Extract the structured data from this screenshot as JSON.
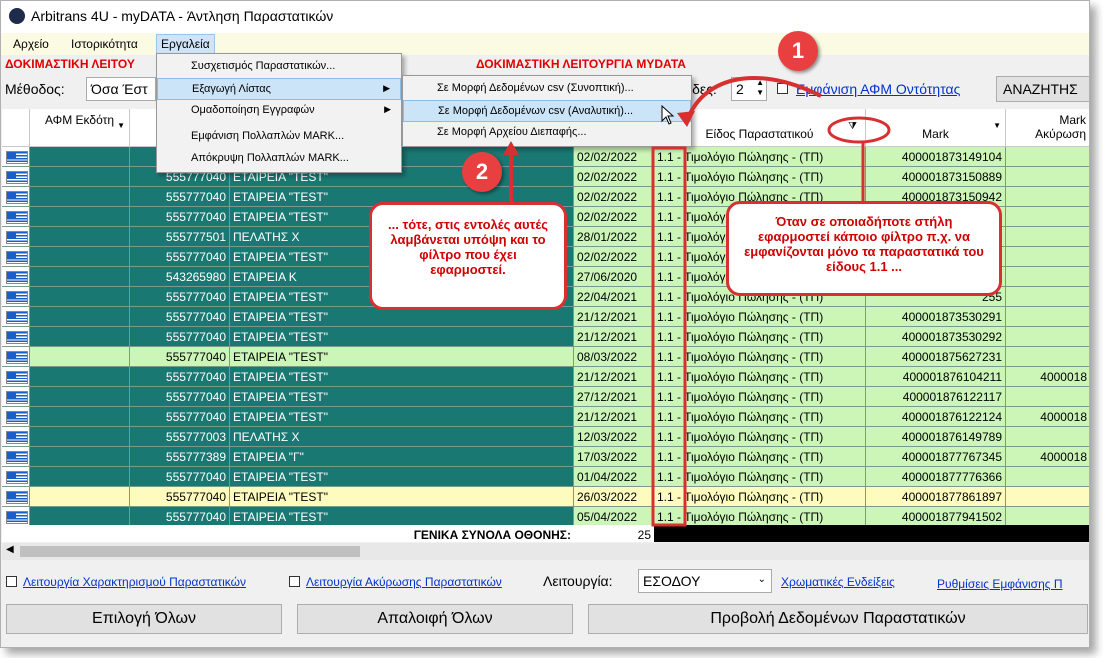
{
  "window": {
    "title": "Arbitrans 4U - myDATA - Άντληση Παραστατικών"
  },
  "menu": {
    "items": [
      "Αρχείο",
      "Ιστορικότητα",
      "Εργαλεία"
    ]
  },
  "banner": {
    "left": "ΔΟΚΙΜΑΣΤΙΚΗ ΛΕΙΤΟΥ",
    "center": "ΔΟΚΙΜΑΣΤΙΚΗ ΛΕΙΤΟΥΡΓΙΑ MYDATA"
  },
  "toolbar": {
    "method_label": "Μέθοδος:",
    "method_value": "Όσα Έστ",
    "pages_label_suffix": "ίδες:",
    "pages_value": "2",
    "show_afm_link": "Εμφάνιση ΑΦΜ Οντότητας",
    "search_button": "ΑΝΑΖΗΤΗΣ"
  },
  "tools_menu": {
    "items": [
      "Συσχετισμός Παραστατικών...",
      "Εξαγωγή Λίστας",
      "Ομαδοποίηση Εγγραφών",
      "Εμφάνιση Πολλαπλών MARK...",
      "Απόκρυψη Πολλαπλών MARK..."
    ]
  },
  "export_submenu": {
    "items": [
      "Σε Μορφή Δεδομένων csv (Συνοπτική)...",
      "Σε Μορφή Δεδομένων csv (Αναλυτική)...",
      "Σε Μορφή Αρχείου Διεπαφής..."
    ]
  },
  "grid": {
    "headers": {
      "afm_issuer": "ΑΦΜ Εκδότη",
      "doc_type": "Είδος Παραστατικού",
      "mark": "Mark",
      "mark_cancel": "Mark Ακύρωση"
    },
    "rows": [
      {
        "afm": "555777040",
        "name": "",
        "date": "02/02/2022",
        "type": "1.1 - Τιμολόγιο Πώλησης - (ΤΠ)",
        "mark": "400001873149104",
        "cancel": "",
        "color": "teal"
      },
      {
        "afm": "555777040",
        "name": "ΕΤΑΙΡΕΙΑ \"TEST\"",
        "date": "02/02/2022",
        "type": "1.1 - Τιμολόγιο Πώλησης - (ΤΠ)",
        "mark": "400001873150889",
        "cancel": "",
        "color": "teal"
      },
      {
        "afm": "555777040",
        "name": "ΕΤΑΙΡΕΙΑ \"TEST\"",
        "date": "02/02/2022",
        "type": "1.1 - Τιμολόγιο Πώλησης - (ΤΠ)",
        "mark": "400001873150942",
        "cancel": "",
        "color": "teal"
      },
      {
        "afm": "555777040",
        "name": "ΕΤΑΙΡΕΙΑ \"TEST\"",
        "date": "02/02/2022",
        "type": "1.1 - Τιμολόγιο Πώλησης - (ΤΠ)",
        "mark": "",
        "cancel": "",
        "color": "teal"
      },
      {
        "afm": "555777501",
        "name": "ΠΕΛΑΤΗΣ Χ",
        "date": "28/01/2022",
        "type": "1.1 - Τιμολόγιο Πώλησης - (ΤΠ)",
        "mark": "",
        "cancel": "",
        "color": "teal"
      },
      {
        "afm": "555777040",
        "name": "ΕΤΑΙΡΕΙΑ \"TEST\"",
        "date": "02/02/2022",
        "type": "1.1 - Τιμολόγιο Πώλησης - (ΤΠ)",
        "mark": "",
        "cancel": "",
        "color": "teal"
      },
      {
        "afm": "543265980",
        "name": "ΕΤΑΙΡΕΙΑ Κ",
        "date": "27/06/2020",
        "type": "1.1 - Τιμολόγιο Πώλησης - (ΤΠ)",
        "mark": "",
        "cancel": "",
        "color": "teal"
      },
      {
        "afm": "555777040",
        "name": "ΕΤΑΙΡΕΙΑ \"TEST\"",
        "date": "22/04/2021",
        "type": "1.1 - Τιμολόγιο Πώλησης - (ΤΠ)",
        "mark": "255",
        "cancel": "",
        "color": "teal"
      },
      {
        "afm": "555777040",
        "name": "ΕΤΑΙΡΕΙΑ \"TEST\"",
        "date": "21/12/2021",
        "type": "1.1 - Τιμολόγιο Πώλησης - (ΤΠ)",
        "mark": "400001873530291",
        "cancel": "",
        "color": "teal"
      },
      {
        "afm": "555777040",
        "name": "ΕΤΑΙΡΕΙΑ \"TEST\"",
        "date": "21/12/2021",
        "type": "1.1 - Τιμολόγιο Πώλησης - (ΤΠ)",
        "mark": "400001873530292",
        "cancel": "",
        "color": "teal"
      },
      {
        "afm": "555777040",
        "name": "ΕΤΑΙΡΕΙΑ \"TEST\"",
        "date": "08/03/2022",
        "type": "1.1 - Τιμολόγιο Πώλησης - (ΤΠ)",
        "mark": "400001875627231",
        "cancel": "",
        "color": "green"
      },
      {
        "afm": "555777040",
        "name": "ΕΤΑΙΡΕΙΑ \"TEST\"",
        "date": "21/12/2021",
        "type": "1.1 - Τιμολόγιο Πώλησης - (ΤΠ)",
        "mark": "400001876104211",
        "cancel": "4000018",
        "color": "teal"
      },
      {
        "afm": "555777040",
        "name": "ΕΤΑΙΡΕΙΑ \"TEST\"",
        "date": "27/12/2021",
        "type": "1.1 - Τιμολόγιο Πώλησης - (ΤΠ)",
        "mark": "400001876122117",
        "cancel": "",
        "color": "teal"
      },
      {
        "afm": "555777040",
        "name": "ΕΤΑΙΡΕΙΑ \"TEST\"",
        "date": "21/12/2021",
        "type": "1.1 - Τιμολόγιο Πώλησης - (ΤΠ)",
        "mark": "400001876122124",
        "cancel": "4000018",
        "color": "teal"
      },
      {
        "afm": "555777003",
        "name": "ΠΕΛΑΤΗΣ Χ",
        "date": "12/03/2022",
        "type": "1.1 - Τιμολόγιο Πώλησης - (ΤΠ)",
        "mark": "400001876149789",
        "cancel": "",
        "color": "teal"
      },
      {
        "afm": "555777389",
        "name": "ΕΤΑΙΡΕΙΑ \"Γ\"",
        "date": "17/03/2022",
        "type": "1.1 - Τιμολόγιο Πώλησης - (ΤΠ)",
        "mark": "400001877767345",
        "cancel": "4000018",
        "color": "teal"
      },
      {
        "afm": "555777040",
        "name": "ΕΤΑΙΡΕΙΑ \"TEST\"",
        "date": "01/04/2022",
        "type": "1.1 - Τιμολόγιο Πώλησης - (ΤΠ)",
        "mark": "400001877776366",
        "cancel": "",
        "color": "teal"
      },
      {
        "afm": "555777040",
        "name": "ΕΤΑΙΡΕΙΑ \"TEST\"",
        "date": "26/03/2022",
        "type": "1.1 - Τιμολόγιο Πώλησης - (ΤΠ)",
        "mark": "400001877861897",
        "cancel": "",
        "color": "yellow"
      },
      {
        "afm": "555777040",
        "name": "ΕΤΑΙΡΕΙΑ \"TEST\"",
        "date": "05/04/2022",
        "type": "1.1 - Τιμολόγιο Πώλησης - (ΤΠ)",
        "mark": "400001877941502",
        "cancel": "",
        "color": "teal"
      }
    ],
    "totals_label": "ΓΕΝΙΚΑ ΣΥΝΟΛΑ ΟΘΟΝΗΣ:",
    "totals_count": "25"
  },
  "bottom": {
    "chk_characterization": "Λειτουργία Χαρακτηρισμού Παραστατικών",
    "chk_cancellation": "Λειτουργία Ακύρωσης Παραστατικών",
    "operation_label": "Λειτουργία:",
    "operation_value": "ΕΣΟΔΟΥ",
    "color_hints": "Χρωματικές Ενδείξεις",
    "display_settings": "Ρυθμίσεις Εμφάνισης Π",
    "btn_select_all": "Επιλογή Όλων",
    "btn_clear_all": "Απαλοιφή Όλων",
    "btn_view_data": "Προβολή Δεδομένων Παραστατικών"
  },
  "callouts": {
    "step1": "1",
    "step2": "2",
    "text1": "Όταν σε οποιαδήποτε στήλη εφαρμοστεί κάποιο φίλτρο π.χ. να εμφανίζονται μόνο τα παραστατικά του είδους 1.1 ...",
    "text2": "... τότε, στις εντολές αυτές λαμβάνεται υπόψη και το φίλτρο που έχει εφαρμοστεί."
  },
  "colors": {
    "teal": "#1a7872",
    "green": "#ccf5b8",
    "yellow": "#fdfcbe",
    "callout_red": "#d83030"
  }
}
